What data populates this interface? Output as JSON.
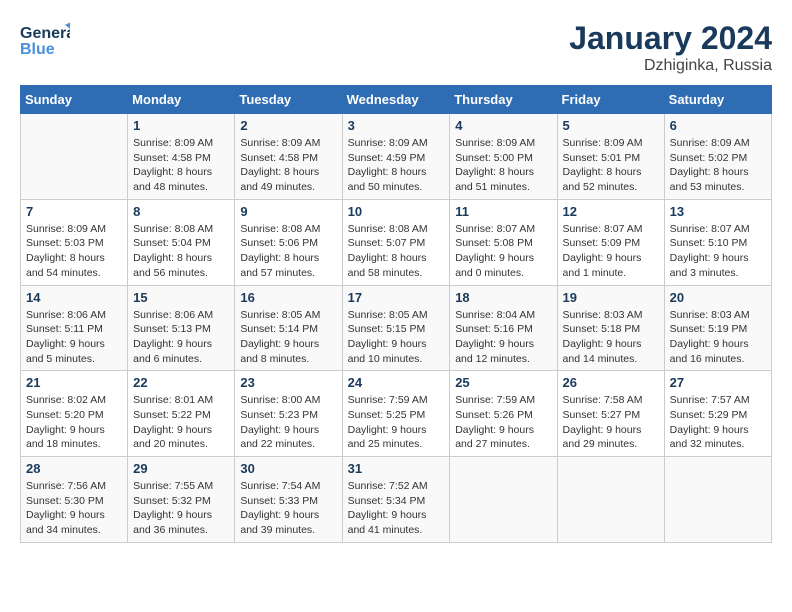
{
  "header": {
    "logo_general": "General",
    "logo_blue": "Blue",
    "month_year": "January 2024",
    "location": "Dzhiginka, Russia"
  },
  "days_of_week": [
    "Sunday",
    "Monday",
    "Tuesday",
    "Wednesday",
    "Thursday",
    "Friday",
    "Saturday"
  ],
  "weeks": [
    [
      {
        "day": "",
        "sunrise": "",
        "sunset": "",
        "daylight": ""
      },
      {
        "day": "1",
        "sunrise": "Sunrise: 8:09 AM",
        "sunset": "Sunset: 4:58 PM",
        "daylight": "Daylight: 8 hours and 48 minutes."
      },
      {
        "day": "2",
        "sunrise": "Sunrise: 8:09 AM",
        "sunset": "Sunset: 4:58 PM",
        "daylight": "Daylight: 8 hours and 49 minutes."
      },
      {
        "day": "3",
        "sunrise": "Sunrise: 8:09 AM",
        "sunset": "Sunset: 4:59 PM",
        "daylight": "Daylight: 8 hours and 50 minutes."
      },
      {
        "day": "4",
        "sunrise": "Sunrise: 8:09 AM",
        "sunset": "Sunset: 5:00 PM",
        "daylight": "Daylight: 8 hours and 51 minutes."
      },
      {
        "day": "5",
        "sunrise": "Sunrise: 8:09 AM",
        "sunset": "Sunset: 5:01 PM",
        "daylight": "Daylight: 8 hours and 52 minutes."
      },
      {
        "day": "6",
        "sunrise": "Sunrise: 8:09 AM",
        "sunset": "Sunset: 5:02 PM",
        "daylight": "Daylight: 8 hours and 53 minutes."
      }
    ],
    [
      {
        "day": "7",
        "sunrise": "Sunrise: 8:09 AM",
        "sunset": "Sunset: 5:03 PM",
        "daylight": "Daylight: 8 hours and 54 minutes."
      },
      {
        "day": "8",
        "sunrise": "Sunrise: 8:08 AM",
        "sunset": "Sunset: 5:04 PM",
        "daylight": "Daylight: 8 hours and 56 minutes."
      },
      {
        "day": "9",
        "sunrise": "Sunrise: 8:08 AM",
        "sunset": "Sunset: 5:06 PM",
        "daylight": "Daylight: 8 hours and 57 minutes."
      },
      {
        "day": "10",
        "sunrise": "Sunrise: 8:08 AM",
        "sunset": "Sunset: 5:07 PM",
        "daylight": "Daylight: 8 hours and 58 minutes."
      },
      {
        "day": "11",
        "sunrise": "Sunrise: 8:07 AM",
        "sunset": "Sunset: 5:08 PM",
        "daylight": "Daylight: 9 hours and 0 minutes."
      },
      {
        "day": "12",
        "sunrise": "Sunrise: 8:07 AM",
        "sunset": "Sunset: 5:09 PM",
        "daylight": "Daylight: 9 hours and 1 minute."
      },
      {
        "day": "13",
        "sunrise": "Sunrise: 8:07 AM",
        "sunset": "Sunset: 5:10 PM",
        "daylight": "Daylight: 9 hours and 3 minutes."
      }
    ],
    [
      {
        "day": "14",
        "sunrise": "Sunrise: 8:06 AM",
        "sunset": "Sunset: 5:11 PM",
        "daylight": "Daylight: 9 hours and 5 minutes."
      },
      {
        "day": "15",
        "sunrise": "Sunrise: 8:06 AM",
        "sunset": "Sunset: 5:13 PM",
        "daylight": "Daylight: 9 hours and 6 minutes."
      },
      {
        "day": "16",
        "sunrise": "Sunrise: 8:05 AM",
        "sunset": "Sunset: 5:14 PM",
        "daylight": "Daylight: 9 hours and 8 minutes."
      },
      {
        "day": "17",
        "sunrise": "Sunrise: 8:05 AM",
        "sunset": "Sunset: 5:15 PM",
        "daylight": "Daylight: 9 hours and 10 minutes."
      },
      {
        "day": "18",
        "sunrise": "Sunrise: 8:04 AM",
        "sunset": "Sunset: 5:16 PM",
        "daylight": "Daylight: 9 hours and 12 minutes."
      },
      {
        "day": "19",
        "sunrise": "Sunrise: 8:03 AM",
        "sunset": "Sunset: 5:18 PM",
        "daylight": "Daylight: 9 hours and 14 minutes."
      },
      {
        "day": "20",
        "sunrise": "Sunrise: 8:03 AM",
        "sunset": "Sunset: 5:19 PM",
        "daylight": "Daylight: 9 hours and 16 minutes."
      }
    ],
    [
      {
        "day": "21",
        "sunrise": "Sunrise: 8:02 AM",
        "sunset": "Sunset: 5:20 PM",
        "daylight": "Daylight: 9 hours and 18 minutes."
      },
      {
        "day": "22",
        "sunrise": "Sunrise: 8:01 AM",
        "sunset": "Sunset: 5:22 PM",
        "daylight": "Daylight: 9 hours and 20 minutes."
      },
      {
        "day": "23",
        "sunrise": "Sunrise: 8:00 AM",
        "sunset": "Sunset: 5:23 PM",
        "daylight": "Daylight: 9 hours and 22 minutes."
      },
      {
        "day": "24",
        "sunrise": "Sunrise: 7:59 AM",
        "sunset": "Sunset: 5:25 PM",
        "daylight": "Daylight: 9 hours and 25 minutes."
      },
      {
        "day": "25",
        "sunrise": "Sunrise: 7:59 AM",
        "sunset": "Sunset: 5:26 PM",
        "daylight": "Daylight: 9 hours and 27 minutes."
      },
      {
        "day": "26",
        "sunrise": "Sunrise: 7:58 AM",
        "sunset": "Sunset: 5:27 PM",
        "daylight": "Daylight: 9 hours and 29 minutes."
      },
      {
        "day": "27",
        "sunrise": "Sunrise: 7:57 AM",
        "sunset": "Sunset: 5:29 PM",
        "daylight": "Daylight: 9 hours and 32 minutes."
      }
    ],
    [
      {
        "day": "28",
        "sunrise": "Sunrise: 7:56 AM",
        "sunset": "Sunset: 5:30 PM",
        "daylight": "Daylight: 9 hours and 34 minutes."
      },
      {
        "day": "29",
        "sunrise": "Sunrise: 7:55 AM",
        "sunset": "Sunset: 5:32 PM",
        "daylight": "Daylight: 9 hours and 36 minutes."
      },
      {
        "day": "30",
        "sunrise": "Sunrise: 7:54 AM",
        "sunset": "Sunset: 5:33 PM",
        "daylight": "Daylight: 9 hours and 39 minutes."
      },
      {
        "day": "31",
        "sunrise": "Sunrise: 7:52 AM",
        "sunset": "Sunset: 5:34 PM",
        "daylight": "Daylight: 9 hours and 41 minutes."
      },
      {
        "day": "",
        "sunrise": "",
        "sunset": "",
        "daylight": ""
      },
      {
        "day": "",
        "sunrise": "",
        "sunset": "",
        "daylight": ""
      },
      {
        "day": "",
        "sunrise": "",
        "sunset": "",
        "daylight": ""
      }
    ]
  ]
}
